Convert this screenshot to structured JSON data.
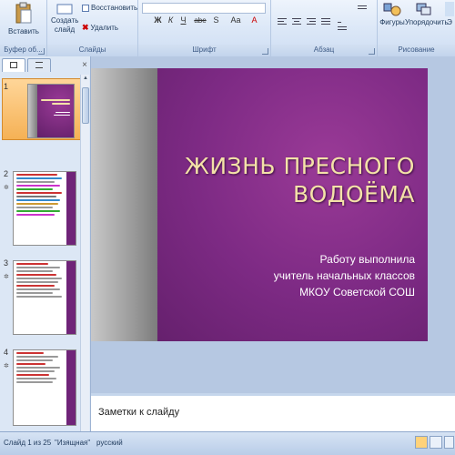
{
  "ribbon": {
    "clipboard": {
      "paste_label": "Вставить",
      "group_label": "Буфер об..."
    },
    "slides": {
      "new_slide_label": "Создать слайд",
      "restore_label": "Восстановить",
      "delete_label": "Удалить",
      "group_label": "Слайды"
    },
    "font": {
      "buttons": [
        "Ж",
        "К",
        "Ч",
        "abe",
        "S",
        "Аа",
        "A"
      ],
      "group_label": "Шрифт"
    },
    "paragraph": {
      "group_label": "Абзац"
    },
    "drawing": {
      "shapes_label": "Фигуры",
      "arrange_label": "Упорядочить",
      "quick_label": "Э",
      "group_label": "Рисование"
    }
  },
  "panel": {
    "tab_slides_icon": "slides-icon",
    "tab_outline_icon": "outline-icon",
    "close_glyph": "×",
    "thumbnails": [
      {
        "number": "1",
        "star": ""
      },
      {
        "number": "2",
        "star": "✲"
      },
      {
        "number": "3",
        "star": "✲"
      },
      {
        "number": "4",
        "star": "✲"
      }
    ]
  },
  "slide": {
    "title_line1": "ЖИЗНЬ ПРЕСНОГО",
    "title_line2": "ВОДОЁМА",
    "subtitle_lines": [
      "Работу выполнила",
      "учитель начальных классов",
      "МКОУ Советской СОШ"
    ]
  },
  "notes": {
    "placeholder": "Заметки к слайду"
  },
  "status": {
    "slide_counter": "Слайд 1 из 25",
    "theme": "\"Изящная\"",
    "language": "русский"
  },
  "colors": {
    "slide_purple": "#7d2a84",
    "title_gold": "#f4e2a8",
    "selection_orange": "#f5b155"
  }
}
